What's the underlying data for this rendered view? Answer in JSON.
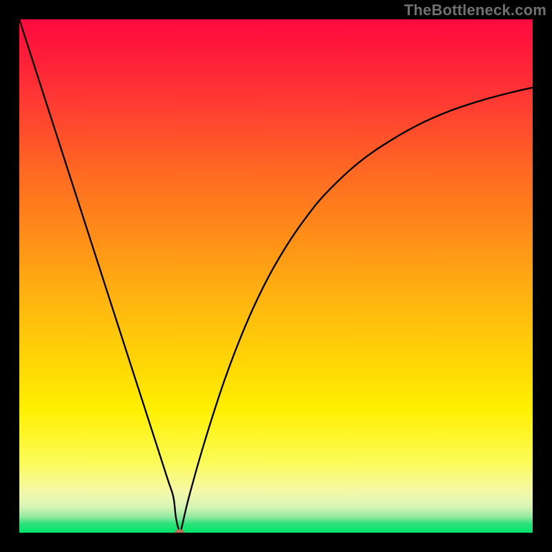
{
  "attribution": "TheBottleneck.com",
  "chart_data": {
    "type": "line",
    "title": "",
    "xlabel": "",
    "ylabel": "",
    "xlim": [
      0,
      100
    ],
    "ylim": [
      0,
      100
    ],
    "grid": false,
    "legend": false,
    "x": [
      0,
      4,
      8,
      12,
      16,
      20,
      24,
      27,
      29,
      30,
      30.5,
      31.0,
      31.4,
      33,
      36,
      40,
      44,
      48,
      52,
      56,
      60,
      66,
      72,
      78,
      84,
      90,
      96,
      100
    ],
    "values": [
      100,
      87.6,
      75.2,
      62.8,
      50.4,
      38.0,
      25.6,
      16.3,
      10.1,
      7.0,
      3.0,
      0.8,
      0.2,
      6.8,
      17.4,
      29.8,
      40.2,
      48.8,
      55.8,
      61.6,
      66.4,
      72.0,
      76.2,
      79.6,
      82.2,
      84.2,
      85.8,
      86.7
    ],
    "min_point": {
      "x": 31.2,
      "y": 0.0
    },
    "background_gradient": {
      "top": "#ff0a40",
      "mid": "#fff000",
      "bottom": "#00e56a"
    },
    "curve_color": "#000000",
    "dot_color": "#b8705a"
  }
}
